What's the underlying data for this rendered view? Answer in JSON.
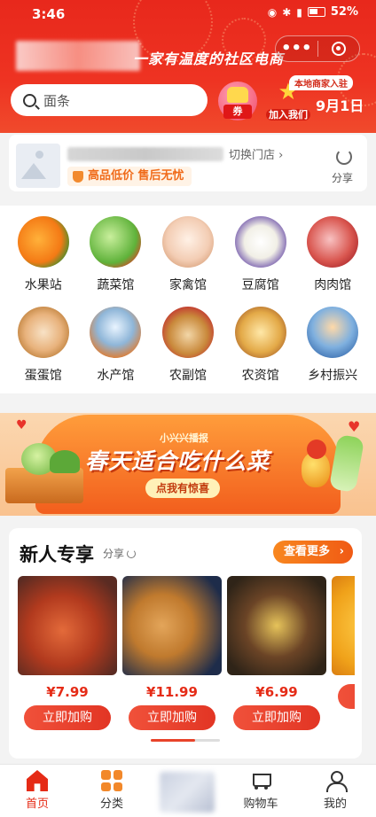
{
  "status_bar": {
    "time": "3:46",
    "battery": "52%"
  },
  "header": {
    "slogan": "一家有温度的社区电商",
    "search_placeholder": "面条",
    "coupon_label": "券",
    "join_label": "加入我们",
    "merchant_badge": "本地商家入驻",
    "date": "9月1日"
  },
  "store": {
    "switch_label": "切换门店",
    "tagline": "高品低价 售后无忧",
    "share_label": "分享"
  },
  "categories": [
    {
      "label": "水果站",
      "icon": "fruit-icon"
    },
    {
      "label": "蔬菜馆",
      "icon": "vegetable-icon"
    },
    {
      "label": "家禽馆",
      "icon": "poultry-icon"
    },
    {
      "label": "豆腐馆",
      "icon": "tofu-icon"
    },
    {
      "label": "肉肉馆",
      "icon": "meat-icon"
    },
    {
      "label": "蛋蛋馆",
      "icon": "egg-icon"
    },
    {
      "label": "水产馆",
      "icon": "seafood-icon"
    },
    {
      "label": "农副馆",
      "icon": "farm-produce-icon"
    },
    {
      "label": "农资馆",
      "icon": "farm-supplies-icon"
    },
    {
      "label": "乡村振兴",
      "icon": "rural-revival-icon"
    }
  ],
  "banner": {
    "subtitle": "小兴兴播报",
    "title": "春天适合吃什么菜",
    "button": "点我有惊喜"
  },
  "new_user": {
    "title": "新人专享",
    "share_label": "分享",
    "more_label": "查看更多",
    "products": [
      {
        "price": "¥7.99",
        "button": "立即加购",
        "image": "dried-persimmon"
      },
      {
        "price": "¥11.99",
        "button": "立即加购",
        "image": "coconut-balls"
      },
      {
        "price": "¥6.99",
        "button": "立即加购",
        "image": "roasted-chestnuts"
      },
      {
        "price": "",
        "button": "",
        "image": "mango"
      }
    ],
    "scroll_progress": 0.64
  },
  "tabbar": {
    "tabs": [
      {
        "label": "首页",
        "icon": "home-icon",
        "active": true
      },
      {
        "label": "分类",
        "icon": "category-icon",
        "active": false
      },
      {
        "label": "",
        "icon": "center-blurred",
        "active": false
      },
      {
        "label": "购物车",
        "icon": "cart-icon",
        "active": false
      },
      {
        "label": "我的",
        "icon": "user-icon",
        "active": false
      }
    ]
  },
  "colors": {
    "brand_red": "#e8281c",
    "accent_orange": "#f06b1a",
    "price_red": "#e52b16"
  }
}
